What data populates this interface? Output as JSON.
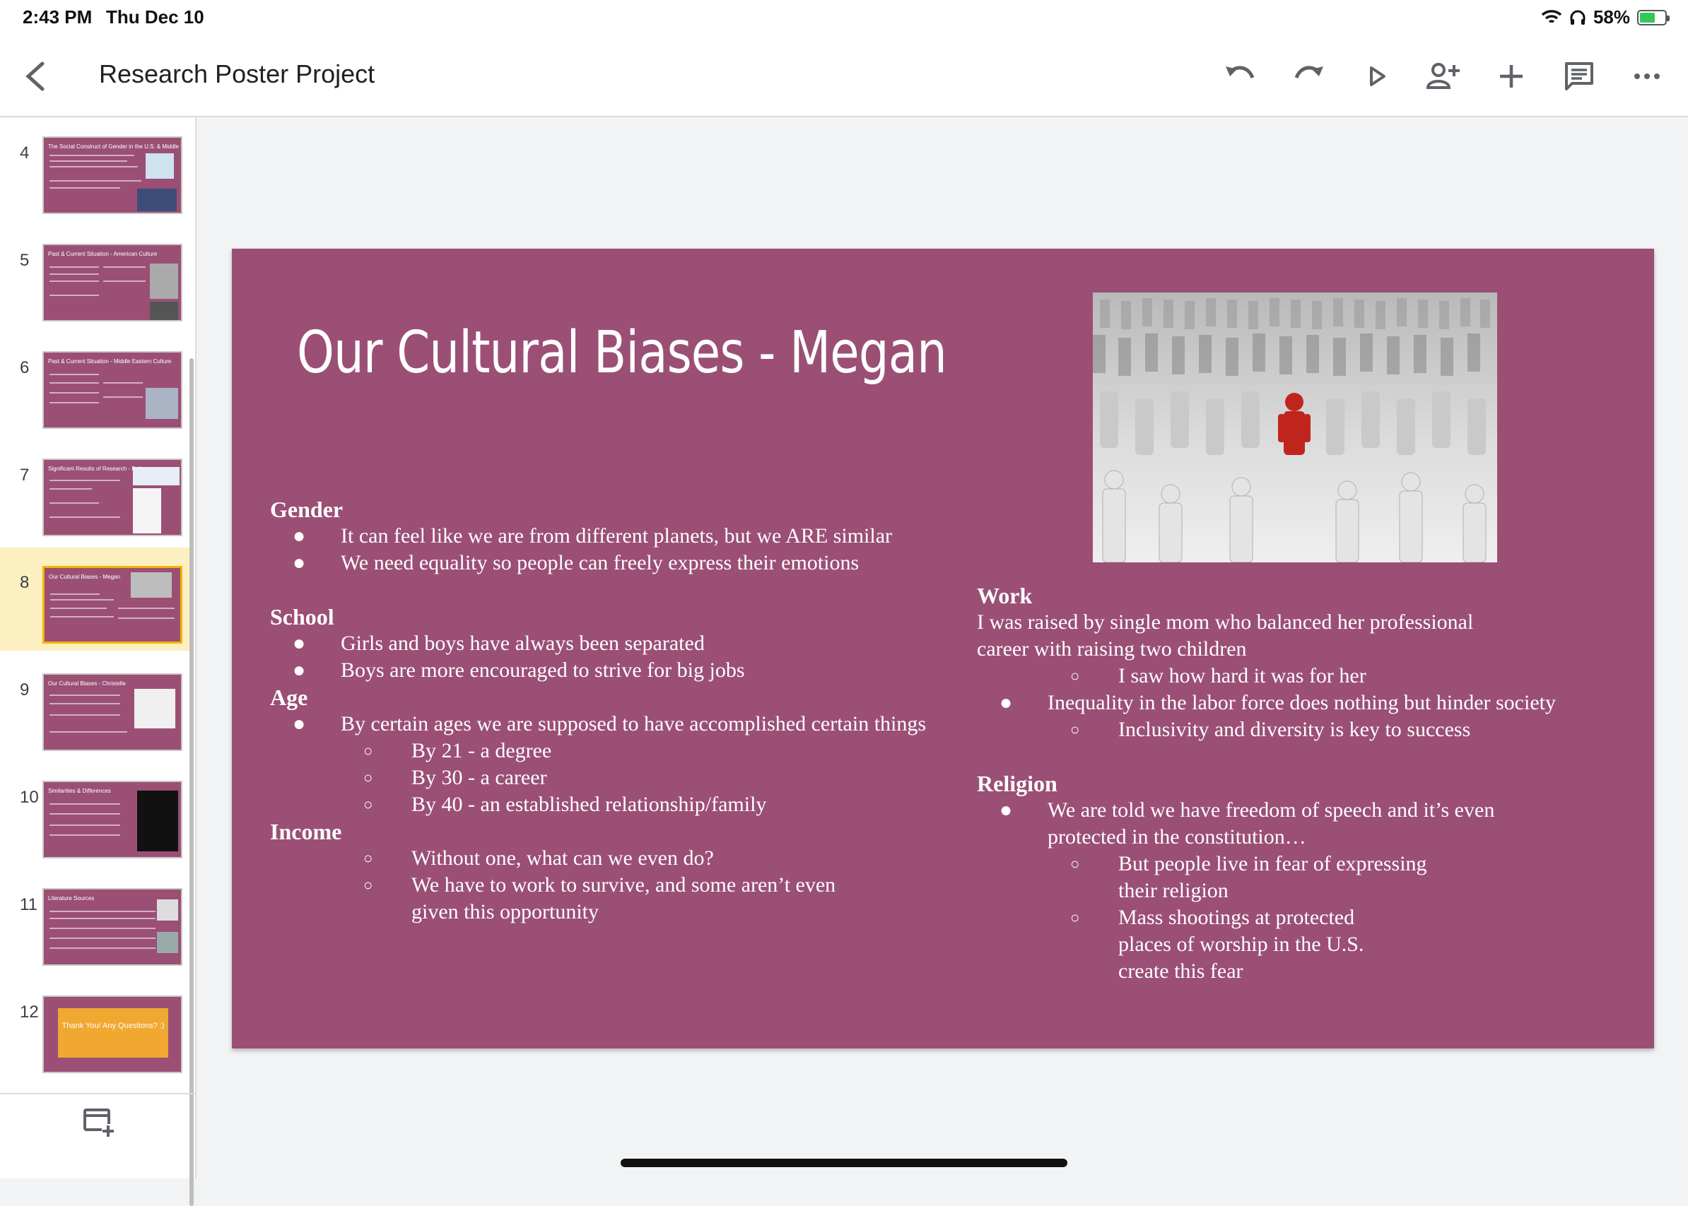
{
  "status_bar": {
    "time": "2:43 PM",
    "date": "Thu Dec 10",
    "battery": "58%",
    "battery_level": 0.58
  },
  "toolbar": {
    "title": "Research Poster Project",
    "icons": [
      "back-icon",
      "undo-icon",
      "redo-icon",
      "present-icon",
      "add-person-icon",
      "add-icon",
      "comment-icon",
      "more-icon"
    ]
  },
  "sidebar": {
    "thumbnails": [
      {
        "number": "4",
        "title": "The Social Construct of Gender in the U.S. & Middle East"
      },
      {
        "number": "5",
        "title": "Past & Current Situation - American Culture"
      },
      {
        "number": "6",
        "title": "Past & Current Situation - Middle Eastern Culture"
      },
      {
        "number": "7",
        "title": "Significant Results of Research - Beth"
      },
      {
        "number": "8",
        "title": "Our Cultural Biases - Megan"
      },
      {
        "number": "9",
        "title": "Our Cultural Biases - Christelle"
      },
      {
        "number": "10",
        "title": "Similarities & Differences"
      },
      {
        "number": "11",
        "title": "Literature Sources"
      },
      {
        "number": "12",
        "title": "Thank You! Any Questions? :)"
      }
    ],
    "selected": "8"
  },
  "slide": {
    "title": "Our Cultural Biases - Megan",
    "background": "#9b4f75",
    "gender": {
      "heading": "Gender",
      "bullets": [
        "It can feel like we are from different planets, but we ARE similar",
        "We need equality so people can freely express their emotions"
      ]
    },
    "school": {
      "heading": "School",
      "bullets": [
        "Girls and boys have always been separated",
        "Boys are more encouraged to strive for big jobs"
      ]
    },
    "age": {
      "heading": "Age",
      "bullet": "By certain ages we are supposed to have accomplished certain things",
      "sub": [
        "By 21 - a degree",
        "By 30 - a career",
        "By 40 - an established relationship/family"
      ]
    },
    "income": {
      "heading": "Income",
      "sub": [
        "Without one, what can we even do?",
        "We have to work to survive, and some aren’t even given this opportunity"
      ]
    },
    "work": {
      "heading": "Work",
      "text": "I was raised by single mom who balanced her professional career with raising two children",
      "sub1": "I saw how hard it was for her",
      "bullet": "Inequality in the labor force does nothing but hinder society",
      "sub2": "Inclusivity and diversity is key to success"
    },
    "religion": {
      "heading": "Religion",
      "bullet": "We are told we have freedom of speech and it’s even protected in the constitution…",
      "sub": [
        "But people live in fear of expressing their religion",
        "Mass shootings at protected places of worship in the U.S. create this fear"
      ]
    }
  }
}
